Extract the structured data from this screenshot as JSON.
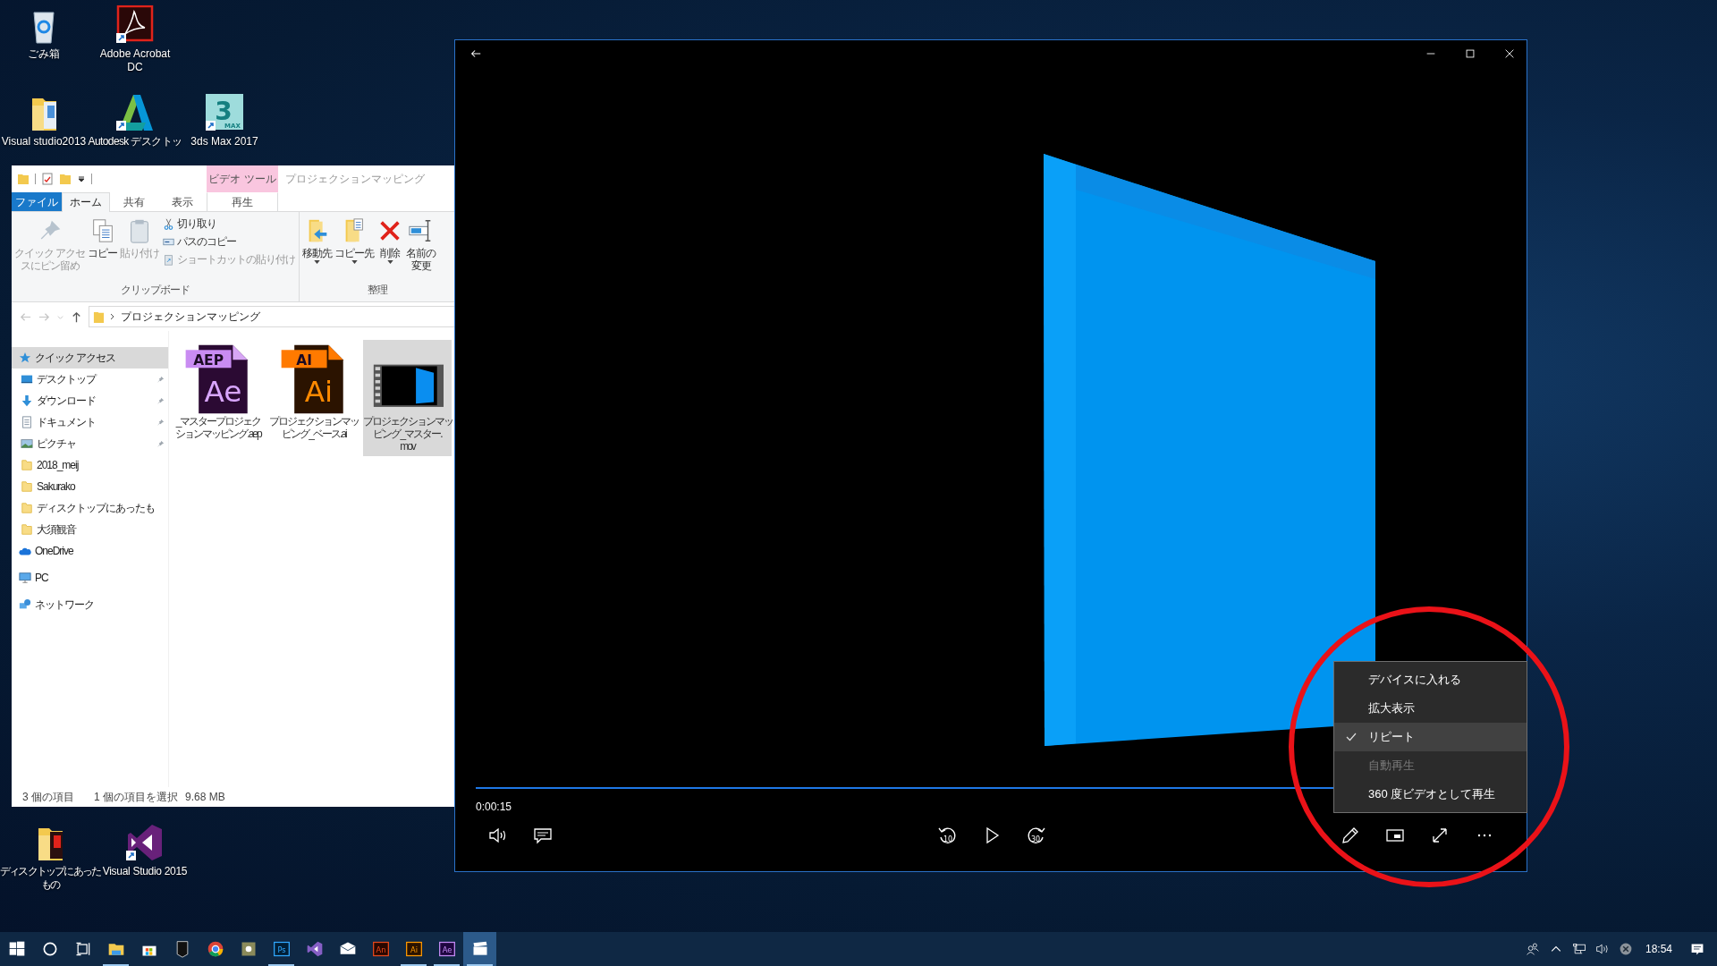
{
  "desktop_icons": [
    {
      "lines": [
        "ごみ箱"
      ],
      "kind": "recycle-bin",
      "shortcut": false
    },
    {
      "lines": [
        "Adobe Acrobat",
        "DC"
      ],
      "kind": "acrobat",
      "shortcut": true
    },
    {
      "lines": [
        "Visual studio2013"
      ],
      "kind": "folder",
      "shortcut": false
    },
    {
      "lines": [
        "Autodesk デスクトッ"
      ],
      "kind": "autodesk",
      "shortcut": true
    },
    {
      "lines": [
        "3ds Max 2017"
      ],
      "kind": "max",
      "shortcut": true,
      "glyph": "3",
      "badge": "MAX"
    },
    {
      "lines": [
        "ディスクトップにあった",
        "もの"
      ],
      "kind": "folder-docs",
      "shortcut": false
    },
    {
      "lines": [
        "Visual Studio 2015"
      ],
      "kind": "visual-studio",
      "shortcut": true
    }
  ],
  "explorer": {
    "context_header": "ビデオ ツール",
    "title": "プロジェクションマッピング",
    "tabs": [
      {
        "label": "ファイル",
        "kind": "file",
        "selected": false
      },
      {
        "label": "ホーム",
        "kind": "plain",
        "selected": true
      },
      {
        "label": "共有",
        "kind": "plain",
        "selected": false
      },
      {
        "label": "表示",
        "kind": "plain",
        "selected": false
      },
      {
        "label": "再生",
        "kind": "context",
        "selected": false
      }
    ],
    "ribbon": [
      {
        "name": "クリップボード",
        "large": [
          {
            "lines": [
              "クイック アクセ",
              "スにピン留め"
            ],
            "kind": "pin",
            "disabled": true,
            "dropdown": false
          },
          {
            "lines": [
              "コピー"
            ],
            "kind": "copy",
            "disabled": false,
            "dropdown": false
          },
          {
            "lines": [
              "貼り付け"
            ],
            "kind": "paste",
            "disabled": true,
            "dropdown": false
          }
        ],
        "small": [
          {
            "label": "切り取り",
            "kind": "cut",
            "disabled": false
          },
          {
            "label": "パスのコピー",
            "kind": "copy-path",
            "disabled": false
          },
          {
            "label": "ショートカットの貼り付け",
            "kind": "paste-shortcut",
            "disabled": true
          }
        ]
      },
      {
        "name": "整理",
        "large": [
          {
            "lines": [
              "移動先"
            ],
            "kind": "move-to",
            "disabled": false,
            "dropdown": true
          },
          {
            "lines": [
              "コピー先"
            ],
            "kind": "copy-to",
            "disabled": false,
            "dropdown": true
          },
          {
            "lines": [
              "削除"
            ],
            "kind": "delete",
            "disabled": false,
            "dropdown": true
          },
          {
            "lines": [
              "名前の",
              "変更"
            ],
            "kind": "rename",
            "disabled": false,
            "dropdown": false
          }
        ]
      }
    ],
    "path": "プロジェクションマッピング",
    "nav": [
      {
        "label": "クイック アクセス",
        "kind": "star",
        "selected": true,
        "children": [
          {
            "label": "デスクトップ",
            "kind": "desktop",
            "pinned": true,
            "selected": false
          },
          {
            "label": "ダウンロード",
            "kind": "download",
            "pinned": true,
            "selected": false
          },
          {
            "label": "ドキュメント",
            "kind": "document",
            "pinned": true,
            "selected": false
          },
          {
            "label": "ピクチャ",
            "kind": "picture",
            "pinned": true,
            "selected": false
          },
          {
            "label": "2018_meij",
            "kind": "folder",
            "pinned": false,
            "selected": false
          },
          {
            "label": "Sakurako",
            "kind": "folder",
            "pinned": false,
            "selected": false
          },
          {
            "label": "ディスクトップにあったも",
            "kind": "folder",
            "pinned": false,
            "selected": false
          },
          {
            "label": "大須観音",
            "kind": "folder",
            "pinned": false,
            "selected": false
          }
        ]
      },
      {
        "label": "OneDrive",
        "kind": "cloud",
        "selected": false
      },
      {
        "label": "PC",
        "kind": "pc",
        "selected": false
      },
      {
        "label": "ネットワーク",
        "kind": "network",
        "selected": false
      }
    ],
    "files": [
      {
        "lines": [
          "_マスタープロジェク",
          "ションマッピング.aep"
        ],
        "kind": "aep",
        "badge": "AEP",
        "glyph": "Ae",
        "selected": false
      },
      {
        "lines": [
          "プロジェクションマッ",
          "ピング_ベース.ai"
        ],
        "kind": "ai",
        "badge": "AI",
        "glyph": "Ai",
        "selected": false
      },
      {
        "lines": [
          "プロジェクションマッ",
          "ピング_マスター.",
          "mov"
        ],
        "kind": "mov",
        "selected": true
      }
    ],
    "status": [
      "3 個の項目",
      "1 個の項目を選択",
      "9.68 MB"
    ]
  },
  "player": {
    "seek": {
      "level": 1
    },
    "time": "0:00:15",
    "skip_back": "10",
    "skip_forward": "30",
    "menu": [
      {
        "label": "デバイスに入れる",
        "checked": false,
        "disabled": false,
        "selected": false
      },
      {
        "label": "拡大表示",
        "checked": false,
        "disabled": false,
        "selected": false
      },
      {
        "label": "リピート",
        "checked": true,
        "disabled": false,
        "selected": true
      },
      {
        "label": "自動再生",
        "checked": false,
        "disabled": true,
        "selected": false
      },
      {
        "label": "360 度ビデオとして再生",
        "checked": false,
        "disabled": false,
        "selected": false
      }
    ]
  },
  "taskbar": {
    "apps": [
      {
        "kind": "start",
        "running": false,
        "selected": false
      },
      {
        "kind": "search",
        "running": false,
        "selected": false
      },
      {
        "kind": "taskview",
        "running": false,
        "selected": false
      },
      {
        "kind": "explorer",
        "running": true,
        "selected": false
      },
      {
        "kind": "store",
        "running": false,
        "selected": false
      },
      {
        "kind": "epic",
        "running": false,
        "selected": false
      },
      {
        "kind": "chrome",
        "running": false,
        "selected": false
      },
      {
        "kind": "app",
        "running": false,
        "selected": false
      },
      {
        "kind": "ps",
        "glyph": "Ps",
        "running": true,
        "selected": false
      },
      {
        "kind": "visual-studio",
        "running": false,
        "selected": false
      },
      {
        "kind": "mail",
        "running": false,
        "selected": false
      },
      {
        "kind": "an",
        "glyph": "An",
        "running": false,
        "selected": false
      },
      {
        "kind": "ai",
        "glyph": "Ai",
        "running": true,
        "selected": false
      },
      {
        "kind": "ae",
        "glyph": "Ae",
        "running": true,
        "selected": false
      },
      {
        "kind": "movies",
        "running": true,
        "selected": true
      }
    ],
    "time": "18:54"
  }
}
